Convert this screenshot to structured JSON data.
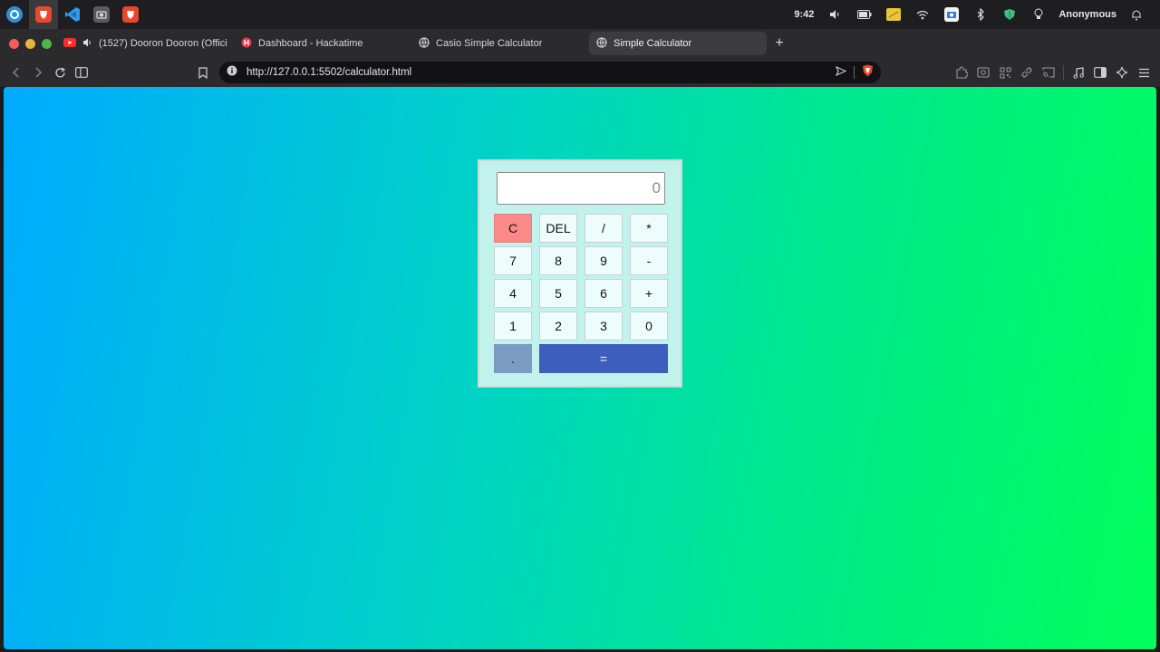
{
  "system_bar": {
    "time": "9:42",
    "user": "Anonymous",
    "dock_icons": [
      "finder-icon",
      "brave-browser-icon",
      "vscode-icon",
      "screenshot-icon",
      "brave-browser-icon"
    ]
  },
  "tabs": [
    {
      "title": "(1527) Dooron Dooron (Official",
      "icon": "youtube-icon",
      "audio": true
    },
    {
      "title": "Dashboard - Hackatime",
      "icon": "hackatime-icon"
    },
    {
      "title": "Casio Simple Calculator",
      "icon": "globe-icon"
    },
    {
      "title": "Simple Calculator",
      "icon": "globe-icon",
      "active": true
    }
  ],
  "new_tab_label": "+",
  "address_bar": {
    "url": "http://127.0.0.1:5502/calculator.html"
  },
  "calculator": {
    "display_value": "0",
    "keys": {
      "clear": "C",
      "delete": "DEL",
      "divide": "/",
      "multiply": "*",
      "seven": "7",
      "eight": "8",
      "nine": "9",
      "subtract": "-",
      "four": "4",
      "five": "5",
      "six": "6",
      "add": "+",
      "one": "1",
      "two": "2",
      "three": "3",
      "zero": "0",
      "decimal": ".",
      "equals": "="
    }
  },
  "colors": {
    "gradient_start": "#00aaff",
    "gradient_end": "#00ff5a",
    "calculator_bg": "#c2f2ec",
    "clear_key": "#f98a87",
    "decimal_key": "#7c9bc2",
    "equals_key": "#3d5ebd"
  }
}
